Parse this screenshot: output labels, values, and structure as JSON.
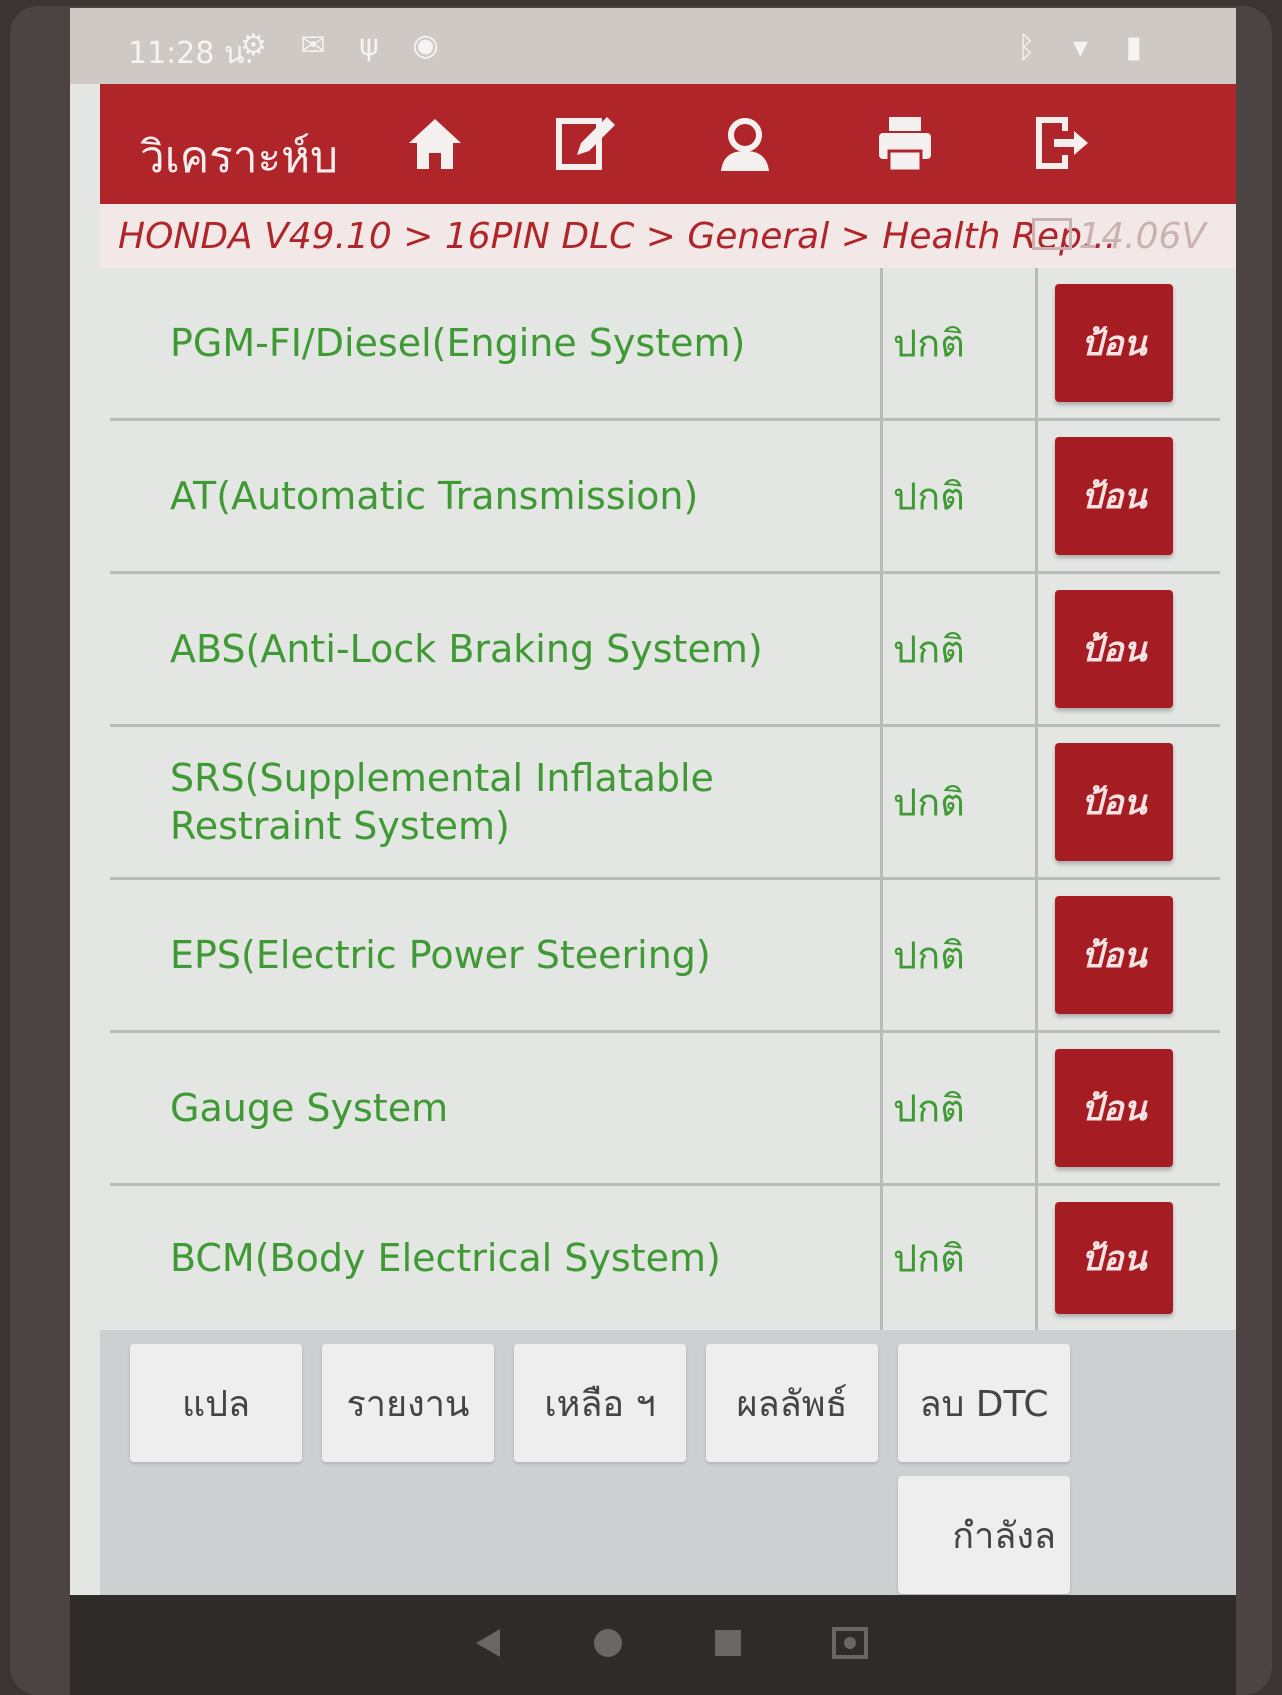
{
  "status": {
    "time": "11:28 น.",
    "icons": [
      "settings-icon",
      "mail-icon",
      "usb-icon",
      "chrome-icon"
    ],
    "right_icons": [
      "bluetooth-icon",
      "wifi-icon",
      "battery-icon"
    ]
  },
  "header": {
    "title": "วิเคราะห์บ",
    "buttons": [
      "home-icon",
      "edit-icon",
      "support-icon",
      "print-icon",
      "exit-icon"
    ]
  },
  "breadcrumb": {
    "path": "HONDA V49.10 > 16PIN DLC > General > Health Rep...",
    "voltage": "14.06V"
  },
  "systems": [
    {
      "name": "PGM-FI/Diesel(Engine System)",
      "status": "ปกติ",
      "action": "ป้อน"
    },
    {
      "name": "AT(Automatic Transmission)",
      "status": "ปกติ",
      "action": "ป้อน"
    },
    {
      "name": "ABS(Anti-Lock Braking System)",
      "status": "ปกติ",
      "action": "ป้อน"
    },
    {
      "name": "SRS(Supplemental Inflatable Restraint System)",
      "status": "ปกติ",
      "action": "ป้อน"
    },
    {
      "name": "EPS(Electric Power Steering)",
      "status": "ปกติ",
      "action": "ป้อน"
    },
    {
      "name": "Gauge System",
      "status": "ปกติ",
      "action": "ป้อน"
    },
    {
      "name": "BCM(Body Electrical System)",
      "status": "ปกติ",
      "action": "ป้อน"
    }
  ],
  "footer": {
    "buttons": [
      "แปล",
      "รายงาน",
      "เหลือ ฯ",
      "ผลลัพธ์",
      "ลบ DTC"
    ],
    "extra_button": "กำลังล"
  },
  "colors": {
    "accent": "#b0252a",
    "text_green": "#3f9a35",
    "button_red": "#a51c22"
  }
}
